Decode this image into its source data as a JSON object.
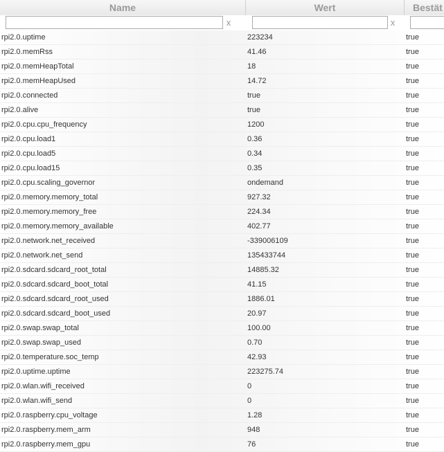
{
  "headers": {
    "name": "Name",
    "value": "Wert",
    "ack": "Bestät"
  },
  "filter": {
    "clear_symbol": "x",
    "name_value": "",
    "value_value": ""
  },
  "rows": [
    {
      "name": "rpi2.0.uptime",
      "value": "223234",
      "ack": "true"
    },
    {
      "name": "rpi2.0.memRss",
      "value": "41.46",
      "ack": "true"
    },
    {
      "name": "rpi2.0.memHeapTotal",
      "value": "18",
      "ack": "true"
    },
    {
      "name": "rpi2.0.memHeapUsed",
      "value": "14.72",
      "ack": "true"
    },
    {
      "name": "rpi2.0.connected",
      "value": "true",
      "ack": "true"
    },
    {
      "name": "rpi2.0.alive",
      "value": "true",
      "ack": "true"
    },
    {
      "name": "rpi2.0.cpu.cpu_frequency",
      "value": "1200",
      "ack": "true"
    },
    {
      "name": "rpi2.0.cpu.load1",
      "value": "0.36",
      "ack": "true"
    },
    {
      "name": "rpi2.0.cpu.load5",
      "value": "0.34",
      "ack": "true"
    },
    {
      "name": "rpi2.0.cpu.load15",
      "value": "0.35",
      "ack": "true"
    },
    {
      "name": "rpi2.0.cpu.scaling_governor",
      "value": "ondemand",
      "ack": "true"
    },
    {
      "name": "rpi2.0.memory.memory_total",
      "value": "927.32",
      "ack": "true"
    },
    {
      "name": "rpi2.0.memory.memory_free",
      "value": "224.34",
      "ack": "true"
    },
    {
      "name": "rpi2.0.memory.memory_available",
      "value": "402.77",
      "ack": "true"
    },
    {
      "name": "rpi2.0.network.net_received",
      "value": "-339006109",
      "ack": "true"
    },
    {
      "name": "rpi2.0.network.net_send",
      "value": "135433744",
      "ack": "true"
    },
    {
      "name": "rpi2.0.sdcard.sdcard_root_total",
      "value": "14885.32",
      "ack": "true"
    },
    {
      "name": "rpi2.0.sdcard.sdcard_boot_total",
      "value": "41.15",
      "ack": "true"
    },
    {
      "name": "rpi2.0.sdcard.sdcard_root_used",
      "value": "1886.01",
      "ack": "true"
    },
    {
      "name": "rpi2.0.sdcard.sdcard_boot_used",
      "value": "20.97",
      "ack": "true"
    },
    {
      "name": "rpi2.0.swap.swap_total",
      "value": "100.00",
      "ack": "true"
    },
    {
      "name": "rpi2.0.swap.swap_used",
      "value": "0.70",
      "ack": "true"
    },
    {
      "name": "rpi2.0.temperature.soc_temp",
      "value": "42.93",
      "ack": "true"
    },
    {
      "name": "rpi2.0.uptime.uptime",
      "value": "223275.74",
      "ack": "true"
    },
    {
      "name": "rpi2.0.wlan.wifi_received",
      "value": "0",
      "ack": "true"
    },
    {
      "name": "rpi2.0.wlan.wifi_send",
      "value": "0",
      "ack": "true"
    },
    {
      "name": "rpi2.0.raspberry.cpu_voltage",
      "value": "1.28",
      "ack": "true"
    },
    {
      "name": "rpi2.0.raspberry.mem_arm",
      "value": "948",
      "ack": "true"
    },
    {
      "name": "rpi2.0.raspberry.mem_gpu",
      "value": "76",
      "ack": "true"
    }
  ]
}
